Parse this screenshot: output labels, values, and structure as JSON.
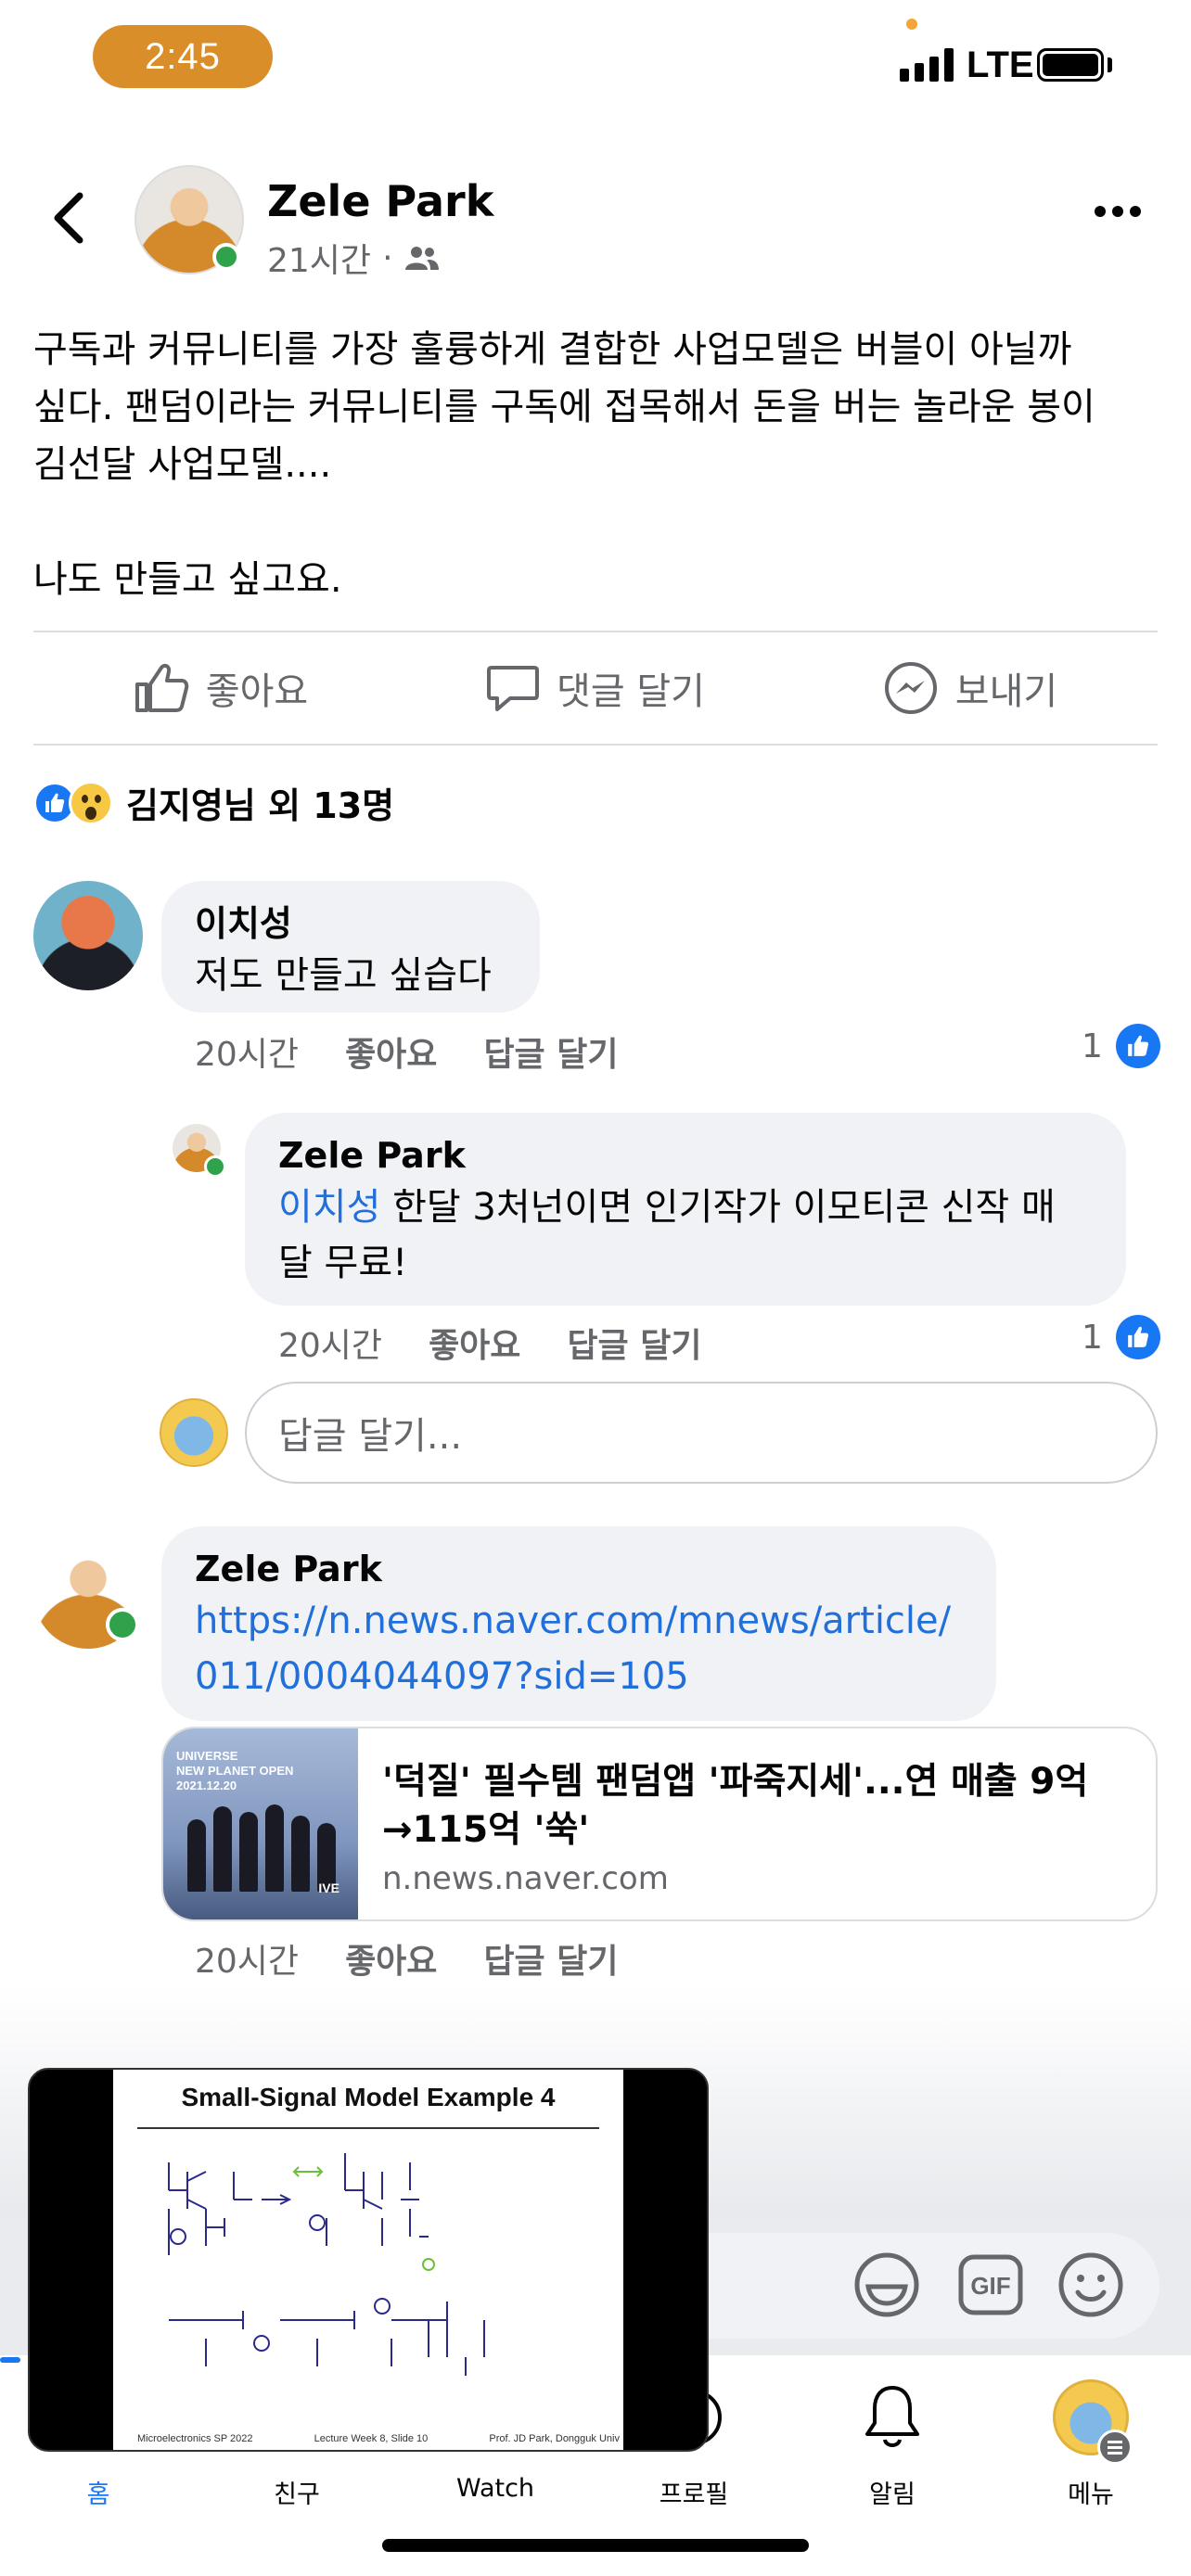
{
  "status_bar": {
    "time": "2:45",
    "network": "LTE"
  },
  "post": {
    "author": "Zele Park",
    "time": "21시간",
    "audience_icon": "friends-icon",
    "text": "구독과 커뮤니티를 가장 훌륭하게 결합한 사업모델은 버블이 아닐까\n싶다. 팬덤이라는 커뮤니티를 구독에 접목해서 돈을 버는 놀라운 봉이\n김선달 사업모델....\n\n나도 만들고 싶고요.",
    "actions": {
      "like": "좋아요",
      "comment": "댓글 달기",
      "send": "보내기"
    },
    "reactions_summary": "김지영님 외 13명"
  },
  "comments": [
    {
      "author": "이치성",
      "text": "저도 만들고 싶습다",
      "time": "20시간",
      "like": "좋아요",
      "reply": "답글 달기",
      "like_count": "1"
    },
    {
      "author": "Zele Park",
      "mention": "이치성",
      "text": " 한달 3처넌이면 인기작가 이모티콘 신작 매\n달 무료!",
      "time": "20시간",
      "like": "좋아요",
      "reply": "답글 달기",
      "like_count": "1"
    },
    {
      "author": "Zele Park",
      "link": "https://n.news.naver.com/mnews/article/\n011/0004044097?sid=105",
      "time": "20시간",
      "like": "좋아요",
      "reply": "답글 달기"
    }
  ],
  "reply_input": {
    "placeholder": "답글 달기..."
  },
  "link_preview": {
    "title": "'덕질' 필수템 팬덤앱 '파죽지세'...연 매출 9억\n→115억 '쑥'",
    "domain": "n.news.naver.com",
    "thumb_text": "UNIVERSE\nNEW PLANET OPEN\n2021.12.20",
    "thumb_badge": "IVE"
  },
  "pip_video": {
    "slide_title": "Small-Signal Model Example 4",
    "footer_left": "Microelectronics SP 2022",
    "footer_center": "Lecture Week 8, Slide 10",
    "footer_right": "Prof. JD Park, Dongguk Univ"
  },
  "tabs": [
    {
      "label": "홈",
      "icon": "home-icon",
      "active": true
    },
    {
      "label": "친구",
      "icon": "friends-icon"
    },
    {
      "label": "Watch",
      "icon": "watch-icon"
    },
    {
      "label": "프로필",
      "icon": "profile-icon"
    },
    {
      "label": "알림",
      "icon": "bell-icon"
    },
    {
      "label": "메뉴",
      "icon": "menu-avatar-icon"
    }
  ],
  "colors": {
    "accent": "#1877f2",
    "link": "#216fdb",
    "time_pill": "#d98e2a",
    "online": "#31a24c"
  }
}
